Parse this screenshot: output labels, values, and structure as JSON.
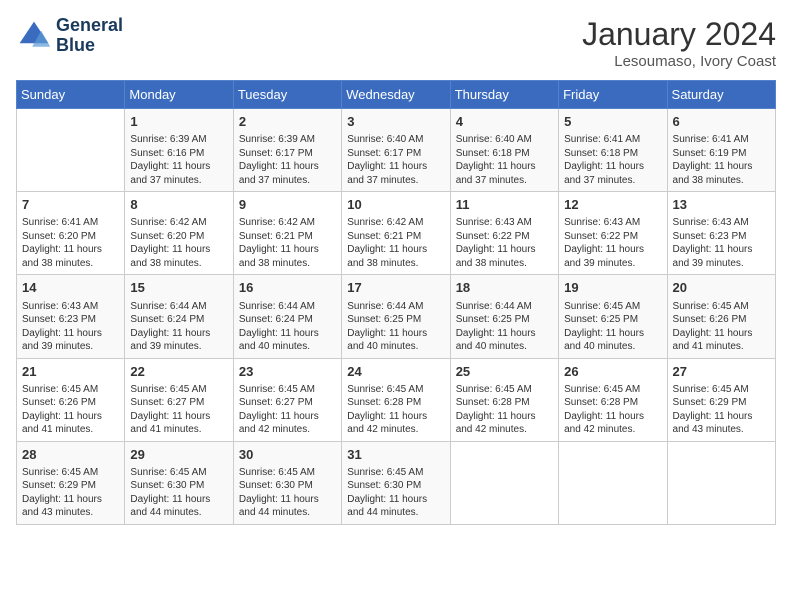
{
  "header": {
    "logo_line1": "General",
    "logo_line2": "Blue",
    "month": "January 2024",
    "location": "Lesoumaso, Ivory Coast"
  },
  "days_of_week": [
    "Sunday",
    "Monday",
    "Tuesday",
    "Wednesday",
    "Thursday",
    "Friday",
    "Saturday"
  ],
  "weeks": [
    [
      {
        "day": "",
        "sunrise": "",
        "sunset": "",
        "daylight": ""
      },
      {
        "day": "1",
        "sunrise": "Sunrise: 6:39 AM",
        "sunset": "Sunset: 6:16 PM",
        "daylight": "Daylight: 11 hours and 37 minutes."
      },
      {
        "day": "2",
        "sunrise": "Sunrise: 6:39 AM",
        "sunset": "Sunset: 6:17 PM",
        "daylight": "Daylight: 11 hours and 37 minutes."
      },
      {
        "day": "3",
        "sunrise": "Sunrise: 6:40 AM",
        "sunset": "Sunset: 6:17 PM",
        "daylight": "Daylight: 11 hours and 37 minutes."
      },
      {
        "day": "4",
        "sunrise": "Sunrise: 6:40 AM",
        "sunset": "Sunset: 6:18 PM",
        "daylight": "Daylight: 11 hours and 37 minutes."
      },
      {
        "day": "5",
        "sunrise": "Sunrise: 6:41 AM",
        "sunset": "Sunset: 6:18 PM",
        "daylight": "Daylight: 11 hours and 37 minutes."
      },
      {
        "day": "6",
        "sunrise": "Sunrise: 6:41 AM",
        "sunset": "Sunset: 6:19 PM",
        "daylight": "Daylight: 11 hours and 38 minutes."
      }
    ],
    [
      {
        "day": "7",
        "sunrise": "Sunrise: 6:41 AM",
        "sunset": "Sunset: 6:20 PM",
        "daylight": "Daylight: 11 hours and 38 minutes."
      },
      {
        "day": "8",
        "sunrise": "Sunrise: 6:42 AM",
        "sunset": "Sunset: 6:20 PM",
        "daylight": "Daylight: 11 hours and 38 minutes."
      },
      {
        "day": "9",
        "sunrise": "Sunrise: 6:42 AM",
        "sunset": "Sunset: 6:21 PM",
        "daylight": "Daylight: 11 hours and 38 minutes."
      },
      {
        "day": "10",
        "sunrise": "Sunrise: 6:42 AM",
        "sunset": "Sunset: 6:21 PM",
        "daylight": "Daylight: 11 hours and 38 minutes."
      },
      {
        "day": "11",
        "sunrise": "Sunrise: 6:43 AM",
        "sunset": "Sunset: 6:22 PM",
        "daylight": "Daylight: 11 hours and 38 minutes."
      },
      {
        "day": "12",
        "sunrise": "Sunrise: 6:43 AM",
        "sunset": "Sunset: 6:22 PM",
        "daylight": "Daylight: 11 hours and 39 minutes."
      },
      {
        "day": "13",
        "sunrise": "Sunrise: 6:43 AM",
        "sunset": "Sunset: 6:23 PM",
        "daylight": "Daylight: 11 hours and 39 minutes."
      }
    ],
    [
      {
        "day": "14",
        "sunrise": "Sunrise: 6:43 AM",
        "sunset": "Sunset: 6:23 PM",
        "daylight": "Daylight: 11 hours and 39 minutes."
      },
      {
        "day": "15",
        "sunrise": "Sunrise: 6:44 AM",
        "sunset": "Sunset: 6:24 PM",
        "daylight": "Daylight: 11 hours and 39 minutes."
      },
      {
        "day": "16",
        "sunrise": "Sunrise: 6:44 AM",
        "sunset": "Sunset: 6:24 PM",
        "daylight": "Daylight: 11 hours and 40 minutes."
      },
      {
        "day": "17",
        "sunrise": "Sunrise: 6:44 AM",
        "sunset": "Sunset: 6:25 PM",
        "daylight": "Daylight: 11 hours and 40 minutes."
      },
      {
        "day": "18",
        "sunrise": "Sunrise: 6:44 AM",
        "sunset": "Sunset: 6:25 PM",
        "daylight": "Daylight: 11 hours and 40 minutes."
      },
      {
        "day": "19",
        "sunrise": "Sunrise: 6:45 AM",
        "sunset": "Sunset: 6:25 PM",
        "daylight": "Daylight: 11 hours and 40 minutes."
      },
      {
        "day": "20",
        "sunrise": "Sunrise: 6:45 AM",
        "sunset": "Sunset: 6:26 PM",
        "daylight": "Daylight: 11 hours and 41 minutes."
      }
    ],
    [
      {
        "day": "21",
        "sunrise": "Sunrise: 6:45 AM",
        "sunset": "Sunset: 6:26 PM",
        "daylight": "Daylight: 11 hours and 41 minutes."
      },
      {
        "day": "22",
        "sunrise": "Sunrise: 6:45 AM",
        "sunset": "Sunset: 6:27 PM",
        "daylight": "Daylight: 11 hours and 41 minutes."
      },
      {
        "day": "23",
        "sunrise": "Sunrise: 6:45 AM",
        "sunset": "Sunset: 6:27 PM",
        "daylight": "Daylight: 11 hours and 42 minutes."
      },
      {
        "day": "24",
        "sunrise": "Sunrise: 6:45 AM",
        "sunset": "Sunset: 6:28 PM",
        "daylight": "Daylight: 11 hours and 42 minutes."
      },
      {
        "day": "25",
        "sunrise": "Sunrise: 6:45 AM",
        "sunset": "Sunset: 6:28 PM",
        "daylight": "Daylight: 11 hours and 42 minutes."
      },
      {
        "day": "26",
        "sunrise": "Sunrise: 6:45 AM",
        "sunset": "Sunset: 6:28 PM",
        "daylight": "Daylight: 11 hours and 42 minutes."
      },
      {
        "day": "27",
        "sunrise": "Sunrise: 6:45 AM",
        "sunset": "Sunset: 6:29 PM",
        "daylight": "Daylight: 11 hours and 43 minutes."
      }
    ],
    [
      {
        "day": "28",
        "sunrise": "Sunrise: 6:45 AM",
        "sunset": "Sunset: 6:29 PM",
        "daylight": "Daylight: 11 hours and 43 minutes."
      },
      {
        "day": "29",
        "sunrise": "Sunrise: 6:45 AM",
        "sunset": "Sunset: 6:30 PM",
        "daylight": "Daylight: 11 hours and 44 minutes."
      },
      {
        "day": "30",
        "sunrise": "Sunrise: 6:45 AM",
        "sunset": "Sunset: 6:30 PM",
        "daylight": "Daylight: 11 hours and 44 minutes."
      },
      {
        "day": "31",
        "sunrise": "Sunrise: 6:45 AM",
        "sunset": "Sunset: 6:30 PM",
        "daylight": "Daylight: 11 hours and 44 minutes."
      },
      {
        "day": "",
        "sunrise": "",
        "sunset": "",
        "daylight": ""
      },
      {
        "day": "",
        "sunrise": "",
        "sunset": "",
        "daylight": ""
      },
      {
        "day": "",
        "sunrise": "",
        "sunset": "",
        "daylight": ""
      }
    ]
  ]
}
